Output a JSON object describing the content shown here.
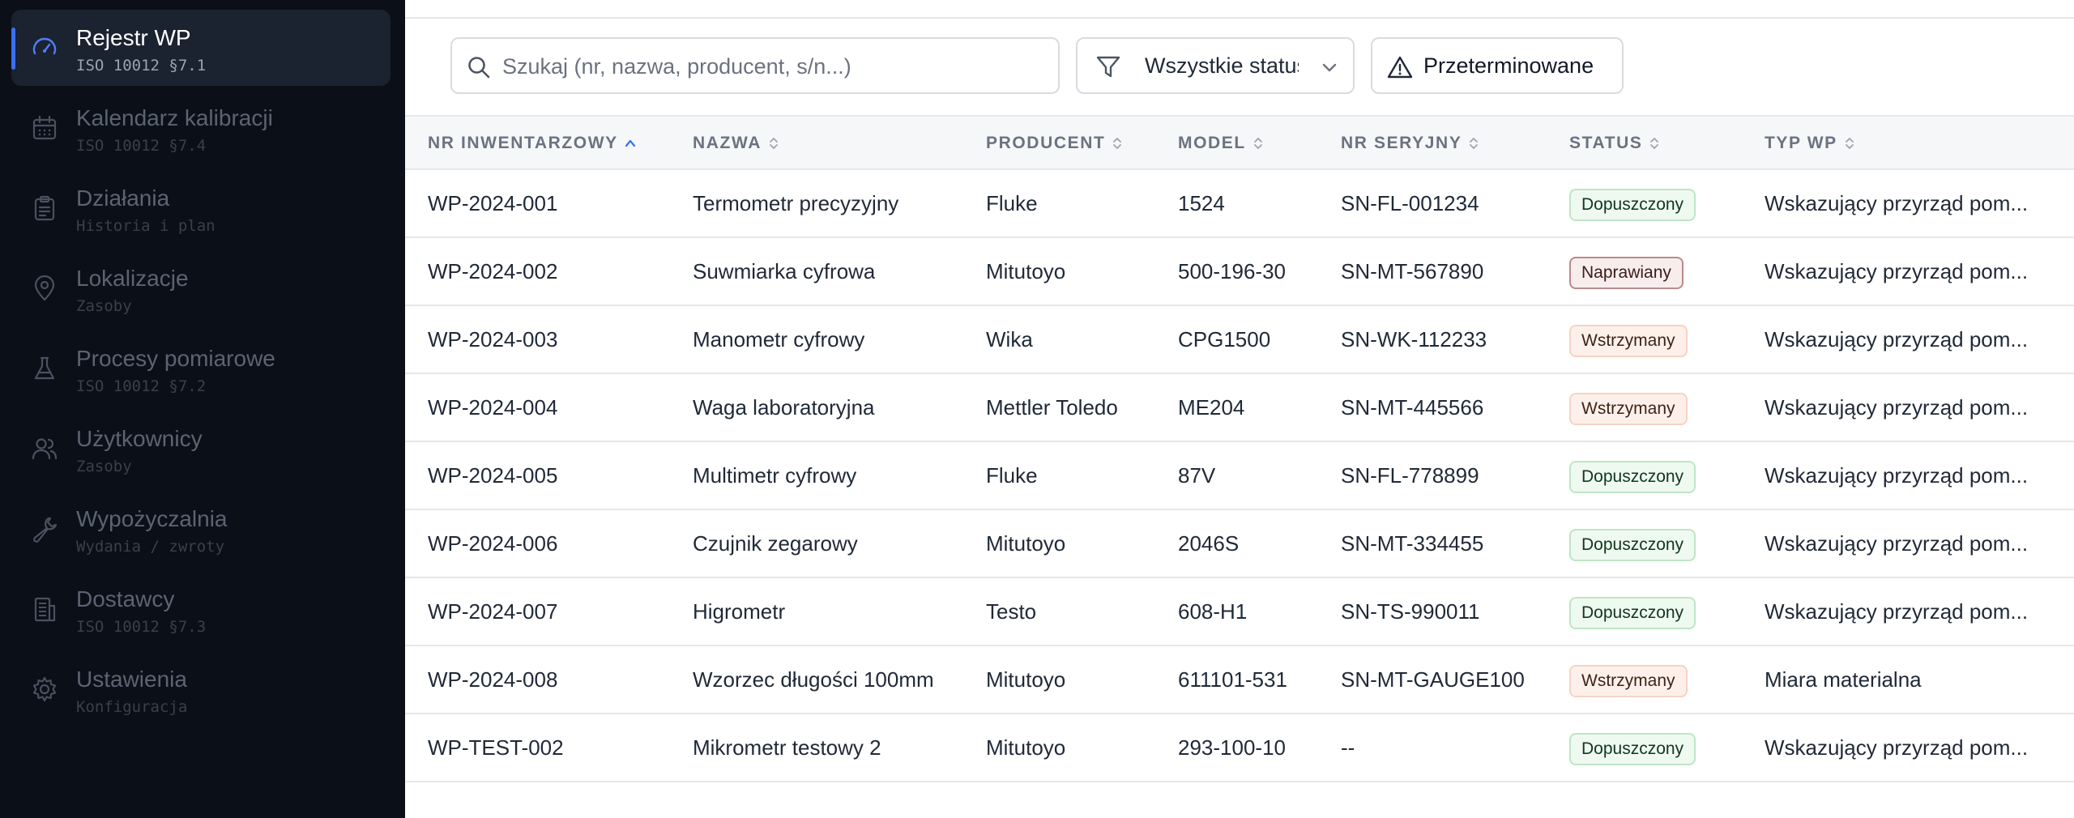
{
  "sidebar": {
    "items": [
      {
        "label": "Rejestr WP",
        "sub": "ISO 10012 §7.1",
        "icon": "gauge-icon",
        "active": true
      },
      {
        "label": "Kalendarz kalibracji",
        "sub": "ISO 10012 §7.4",
        "icon": "calendar-icon",
        "active": false
      },
      {
        "label": "Działania",
        "sub": "Historia i plan",
        "icon": "clipboard-icon",
        "active": false
      },
      {
        "label": "Lokalizacje",
        "sub": "Zasoby",
        "icon": "map-pin-icon",
        "active": false
      },
      {
        "label": "Procesy pomiarowe",
        "sub": "ISO 10012 §7.2",
        "icon": "flask-icon",
        "active": false
      },
      {
        "label": "Użytkownicy",
        "sub": "Zasoby",
        "icon": "users-icon",
        "active": false
      },
      {
        "label": "Wypożyczalnia",
        "sub": "Wydania / zwroty",
        "icon": "wrench-icon",
        "active": false
      },
      {
        "label": "Dostawcy",
        "sub": "ISO 10012 §7.3",
        "icon": "building-icon",
        "active": false
      },
      {
        "label": "Ustawienia",
        "sub": "Konfiguracja",
        "icon": "gear-icon",
        "active": false
      }
    ]
  },
  "toolbar": {
    "search_placeholder": "Szukaj (nr, nazwa, producent, s/n...)",
    "status_filter": "Wszystkie statusy",
    "overdue_label": "Przeterminowane"
  },
  "table": {
    "columns": [
      "NR INWENTARZOWY",
      "NAZWA",
      "PRODUCENT",
      "MODEL",
      "NR SERYJNY",
      "STATUS",
      "TYP WP"
    ],
    "sorted_column": "NR INWENTARZOWY",
    "sort_direction": "asc",
    "rows": [
      {
        "nr": "WP-2024-001",
        "nazwa": "Termometr precyzyjny",
        "producent": "Fluke",
        "model": "1524",
        "serial": "SN-FL-001234",
        "status": "Dopuszczony",
        "status_kind": "ok",
        "typ": "Wskazujący przyrząd pom..."
      },
      {
        "nr": "WP-2024-002",
        "nazwa": "Suwmiarka cyfrowa",
        "producent": "Mitutoyo",
        "model": "500-196-30",
        "serial": "SN-MT-567890",
        "status": "Naprawiany",
        "status_kind": "repair",
        "typ": "Wskazujący przyrząd pom..."
      },
      {
        "nr": "WP-2024-003",
        "nazwa": "Manometr cyfrowy",
        "producent": "Wika",
        "model": "CPG1500",
        "serial": "SN-WK-112233",
        "status": "Wstrzymany",
        "status_kind": "hold",
        "typ": "Wskazujący przyrząd pom..."
      },
      {
        "nr": "WP-2024-004",
        "nazwa": "Waga laboratoryjna",
        "producent": "Mettler Toledo",
        "model": "ME204",
        "serial": "SN-MT-445566",
        "status": "Wstrzymany",
        "status_kind": "hold",
        "typ": "Wskazujący przyrząd pom..."
      },
      {
        "nr": "WP-2024-005",
        "nazwa": "Multimetr cyfrowy",
        "producent": "Fluke",
        "model": "87V",
        "serial": "SN-FL-778899",
        "status": "Dopuszczony",
        "status_kind": "ok",
        "typ": "Wskazujący przyrząd pom..."
      },
      {
        "nr": "WP-2024-006",
        "nazwa": "Czujnik zegarowy",
        "producent": "Mitutoyo",
        "model": "2046S",
        "serial": "SN-MT-334455",
        "status": "Dopuszczony",
        "status_kind": "ok",
        "typ": "Wskazujący przyrząd pom..."
      },
      {
        "nr": "WP-2024-007",
        "nazwa": "Higrometr",
        "producent": "Testo",
        "model": "608-H1",
        "serial": "SN-TS-990011",
        "status": "Dopuszczony",
        "status_kind": "ok",
        "typ": "Wskazujący przyrząd pom..."
      },
      {
        "nr": "WP-2024-008",
        "nazwa": "Wzorzec długości 100mm",
        "producent": "Mitutoyo",
        "model": "611101-531",
        "serial": "SN-MT-GAUGE100",
        "status": "Wstrzymany",
        "status_kind": "hold",
        "typ": "Miara materialna"
      },
      {
        "nr": "WP-TEST-002",
        "nazwa": "Mikrometr testowy 2",
        "producent": "Mitutoyo",
        "model": "293-100-10",
        "serial": "--",
        "status": "Dopuszczony",
        "status_kind": "ok",
        "typ": "Wskazujący przyrząd pom..."
      }
    ]
  },
  "colors": {
    "sidebar_bg": "#0b0f17",
    "active_item_bg": "#1b2230",
    "accent": "#3b6ff0",
    "badge_ok": "#eef9f0",
    "badge_repair": "#f8eded",
    "badge_hold": "#fdf0ea"
  }
}
